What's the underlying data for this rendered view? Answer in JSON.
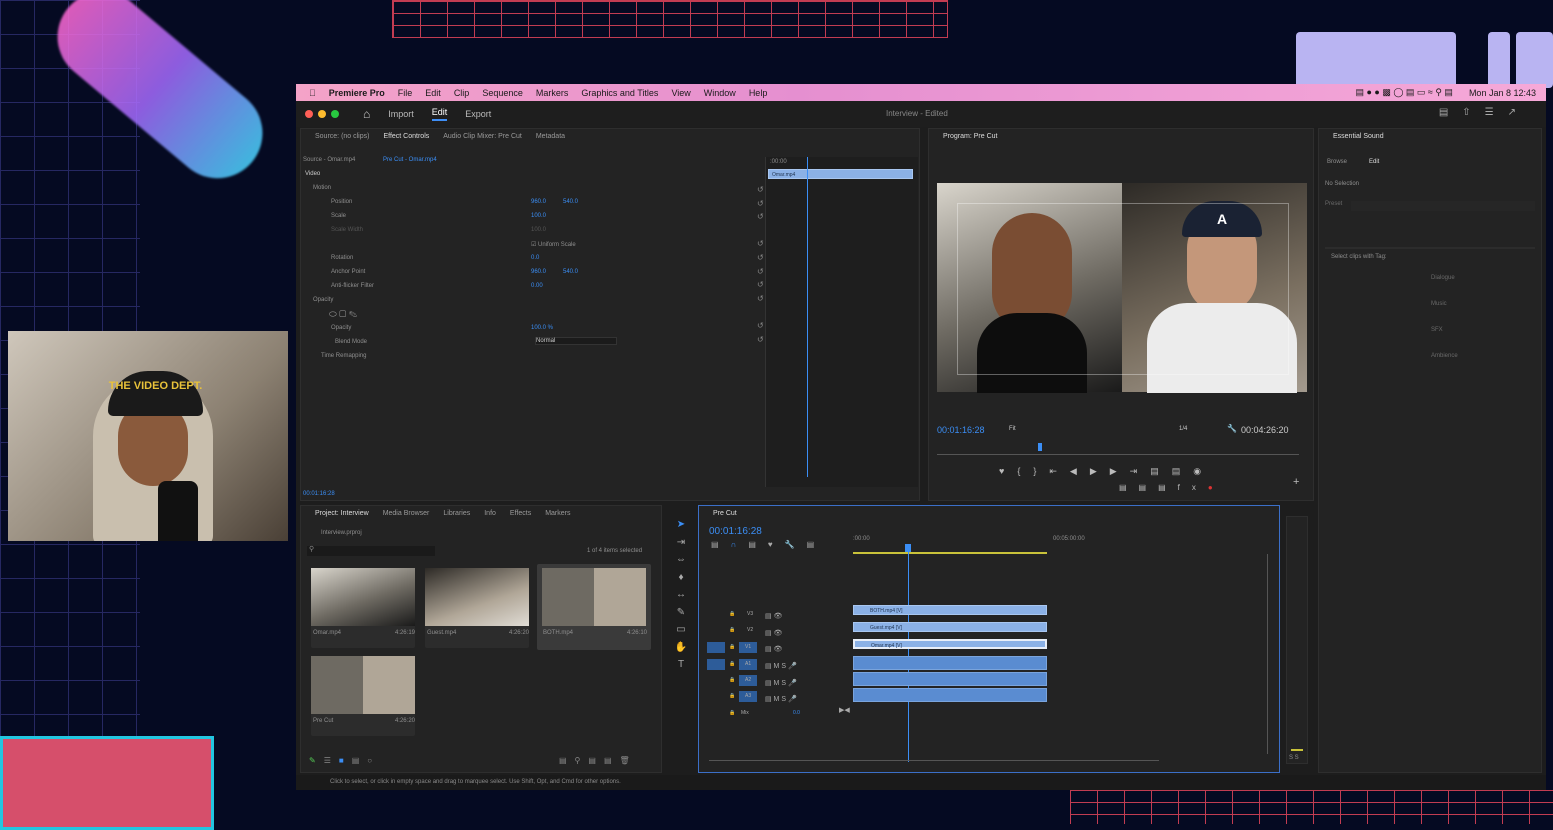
{
  "menubar": {
    "brand": "Premiere Pro",
    "items": [
      "File",
      "Edit",
      "Clip",
      "Sequence",
      "Markers",
      "Graphics and Titles",
      "View",
      "Window",
      "Help"
    ],
    "clock": "Mon Jan 8  12:43"
  },
  "header": {
    "nav": [
      "Import",
      "Edit",
      "Export"
    ],
    "title": "Interview - Edited"
  },
  "webcam": {
    "cap_text": "THE VIDEO DEPT."
  },
  "source_panel": {
    "tabs": [
      "Source: (no clips)",
      "Effect Controls",
      "Audio Clip Mixer: Pre Cut",
      "Metadata"
    ],
    "source_label": "Source - Omar.mp4",
    "sequence_label": "Pre Cut - Omar.mp4",
    "section": "Video",
    "time_start": ":00:00",
    "clip_name": "Omar.mp4",
    "rows": [
      {
        "label": "Motion"
      },
      {
        "label": "Position",
        "v1": "960.0",
        "v2": "540.0"
      },
      {
        "label": "Scale",
        "v1": "100.0"
      },
      {
        "label": "Scale Width",
        "v1": "100.0"
      },
      {
        "label": "Uniform Scale"
      },
      {
        "label": "Rotation",
        "v1": "0.0"
      },
      {
        "label": "Anchor Point",
        "v1": "960.0",
        "v2": "540.0"
      },
      {
        "label": "Anti-flicker Filter",
        "v1": "0.00"
      },
      {
        "label": "Opacity"
      },
      {
        "label": "Opacity",
        "v1": "100.0 %"
      },
      {
        "label": "Blend Mode",
        "v1": "Normal"
      },
      {
        "label": "Time Remapping"
      }
    ],
    "timecode": "00:01:16:28"
  },
  "program": {
    "tab": "Program: Pre Cut",
    "timecode": "00:01:16:28",
    "fit": "Fit",
    "quality": "1/4",
    "duration": "00:04:26:20"
  },
  "essential_sound": {
    "tab": "Essential Sound",
    "subtabs": [
      "Browse",
      "Edit"
    ],
    "no_selection": "No Selection",
    "preset": "Preset",
    "select_clips": "Select clips with Tag:",
    "tags": [
      "Dialogue",
      "Music",
      "SFX",
      "Ambience"
    ]
  },
  "project": {
    "tabs": [
      "Project: Interview",
      "Media Browser",
      "Libraries",
      "Info",
      "Effects",
      "Markers"
    ],
    "file": "Interview.prproj",
    "selected": "1 of 4 items selected",
    "items": [
      {
        "name": "Omar.mp4",
        "duration": "4:26:19"
      },
      {
        "name": "Guest.mp4",
        "duration": "4:26:20"
      },
      {
        "name": "BOTH.mp4",
        "duration": "4:26:10"
      },
      {
        "name": "Pre Cut",
        "duration": "4:26:20"
      }
    ]
  },
  "timeline": {
    "tab": "Pre Cut",
    "timecode": "00:01:16:28",
    "ruler": [
      ":00:00",
      "00:05:00:00"
    ],
    "video_tracks": [
      {
        "label": "V3",
        "clip": "BOTH.mp4 [V]"
      },
      {
        "label": "V2",
        "clip": "Guest.mp4 [V]"
      },
      {
        "label": "V1",
        "clip": "Omar.mp4 [V]"
      }
    ],
    "audio_tracks": [
      "A1",
      "A2",
      "A3"
    ],
    "mix_label": "Mix",
    "mix_value": "0.0",
    "meter_label": "S S"
  },
  "statusbar": "Click to select, or click in empty space and drag to marquee select. Use Shift, Opt, and Cmd for other options."
}
